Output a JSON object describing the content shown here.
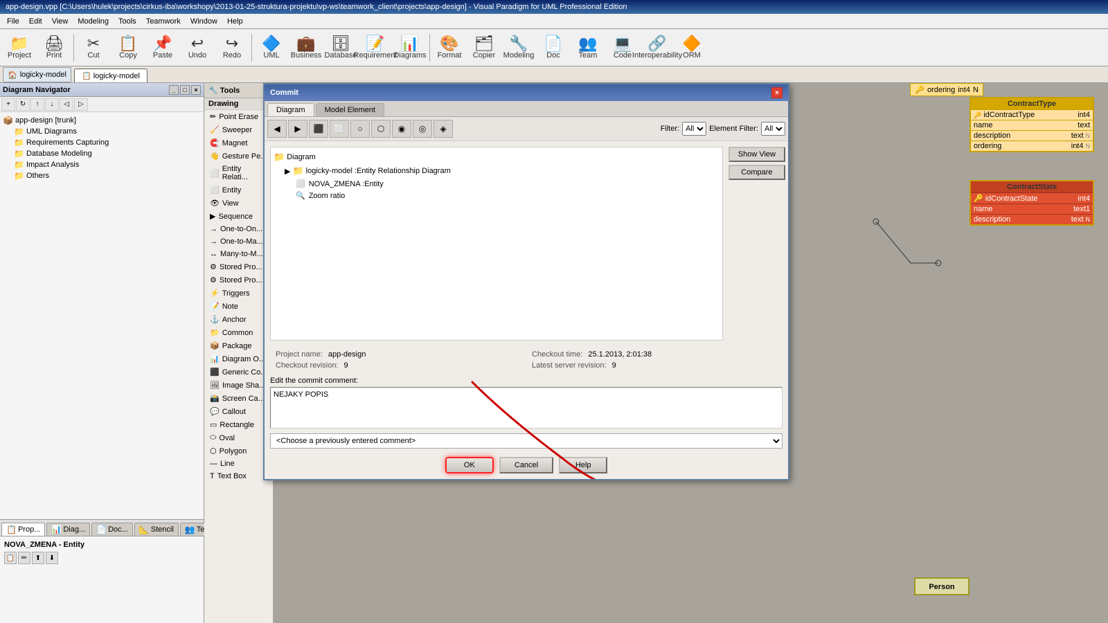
{
  "titlebar": {
    "text": "app-design.vpp [C:\\Users\\hulek\\projects\\cirkus-iba\\workshopy\\2013-01-25-struktura-projektu\\vp-ws\\teamwork_client\\projects\\app-design] - Visual Paradigm for UML Professional Edition"
  },
  "menu": {
    "items": [
      "File",
      "Edit",
      "View",
      "Modeling",
      "Tools",
      "Teamwork",
      "Window",
      "Help"
    ]
  },
  "toolbar": {
    "buttons": [
      {
        "label": "Project",
        "icon": "📁"
      },
      {
        "label": "Print",
        "icon": "🖨"
      },
      {
        "label": "Cut",
        "icon": "✂"
      },
      {
        "label": "Copy",
        "icon": "📋"
      },
      {
        "label": "Paste",
        "icon": "📌"
      },
      {
        "label": "Undo",
        "icon": "↩"
      },
      {
        "label": "Redo",
        "icon": "↪"
      },
      {
        "label": "UML",
        "icon": "🔷"
      },
      {
        "label": "Business",
        "icon": "💼"
      },
      {
        "label": "Database",
        "icon": "🗄"
      },
      {
        "label": "Requirement",
        "icon": "📝"
      },
      {
        "label": "Diagrams",
        "icon": "📊"
      },
      {
        "label": "Format",
        "icon": "🎨"
      },
      {
        "label": "Copier",
        "icon": "🗂"
      },
      {
        "label": "Modeling",
        "icon": "🔧"
      },
      {
        "label": "Doc",
        "icon": "📄"
      },
      {
        "label": "Team",
        "icon": "👥"
      },
      {
        "label": "Code",
        "icon": "💻"
      },
      {
        "label": "Interoperability",
        "icon": "🔗"
      },
      {
        "label": "ORM",
        "icon": "🔶"
      }
    ]
  },
  "nav_panel": {
    "title": "Diagram Navigator",
    "tree": [
      {
        "label": "app-design [trunk]",
        "icon": "📦",
        "level": 0
      },
      {
        "label": "UML Diagrams",
        "icon": "📁",
        "level": 1
      },
      {
        "label": "Requirements Capturing",
        "icon": "📁",
        "level": 1
      },
      {
        "label": "Database Modeling",
        "icon": "📁",
        "level": 1
      },
      {
        "label": "Impact Analysis",
        "icon": "📁",
        "level": 1
      },
      {
        "label": "Others",
        "icon": "📁",
        "level": 1
      }
    ]
  },
  "diagram_tab": "logicky-model",
  "tools_panel": {
    "title": "Tools",
    "items": [
      {
        "label": "Point Erase",
        "icon": "✏"
      },
      {
        "label": "Sweeper",
        "icon": "🧹"
      },
      {
        "label": "Magnet",
        "icon": "🧲"
      },
      {
        "label": "Gesture Pe...",
        "icon": "👋"
      },
      {
        "label": "Entity Relati...",
        "icon": "🔗"
      },
      {
        "label": "Entity",
        "icon": "⬜"
      },
      {
        "label": "View",
        "icon": "👁"
      },
      {
        "label": "Sequence",
        "icon": "▶"
      },
      {
        "label": "One-to-On...",
        "icon": "→"
      },
      {
        "label": "One-to-Ma...",
        "icon": "→"
      },
      {
        "label": "Many-to-M...",
        "icon": "↔"
      },
      {
        "label": "Stored Pro...",
        "icon": "⚙"
      },
      {
        "label": "Stored Pro...",
        "icon": "⚙"
      },
      {
        "label": "Triggers",
        "icon": "⚡"
      },
      {
        "label": "Note",
        "icon": "📝"
      },
      {
        "label": "Anchor",
        "icon": "⚓"
      },
      {
        "label": "Common",
        "icon": "📁"
      },
      {
        "label": "Package",
        "icon": "📦"
      },
      {
        "label": "Diagram O...",
        "icon": "📊"
      },
      {
        "label": "Generic Co...",
        "icon": "⬛"
      },
      {
        "label": "Image Sha...",
        "icon": "🖼"
      },
      {
        "label": "Screen Ca...",
        "icon": "📸"
      },
      {
        "label": "Callout",
        "icon": "💬"
      },
      {
        "label": "Rectangle",
        "icon": "▭"
      },
      {
        "label": "Oval",
        "icon": "⬭"
      },
      {
        "label": "Polygon",
        "icon": "⬡"
      },
      {
        "label": "Line",
        "icon": "—"
      },
      {
        "label": "Text Box",
        "icon": "T"
      }
    ]
  },
  "bottom_tabs": [
    {
      "label": "Prop...",
      "icon": "📋"
    },
    {
      "label": "Diag...",
      "icon": "📊"
    },
    {
      "label": "Doc...",
      "icon": "📄"
    },
    {
      "label": "Stencil",
      "icon": "📐"
    },
    {
      "label": "Te...",
      "icon": "👥"
    }
  ],
  "property": {
    "title": "NOVA_ZMENA - Entity"
  },
  "modal": {
    "title": "Commit",
    "tabs": [
      "Diagram",
      "Model Element"
    ],
    "active_tab": "Diagram",
    "tree": [
      {
        "label": "Diagram",
        "type": "folder"
      },
      {
        "label": "logicky-model :Entity Relationship Diagram",
        "type": "folder",
        "parent": true
      },
      {
        "label": "NOVA_ZMENA :Entity",
        "type": "item"
      },
      {
        "label": "Zoom ratio",
        "type": "item"
      }
    ],
    "show_view_btn": "Show View",
    "compare_btn": "Compare",
    "fields": [
      {
        "label": "Project name:",
        "value": "app-design"
      },
      {
        "label": "Checkout revision:",
        "value": "9"
      },
      {
        "label": "Checkout time:",
        "value": "25.1.2013, 2:01:38"
      },
      {
        "label": "Latest server revision:",
        "value": "9"
      }
    ],
    "comment_label": "Edit the commit comment:",
    "comment_value": "NEJAKY POPIS",
    "dropdown_placeholder": "<Choose a previously entered comment>",
    "buttons": [
      {
        "label": "OK",
        "id": "ok"
      },
      {
        "label": "Cancel",
        "id": "cancel"
      },
      {
        "label": "Help",
        "id": "help"
      }
    ]
  },
  "uml": {
    "contract_type": {
      "title": "ContractType",
      "fields": [
        {
          "key": true,
          "name": "idContractType",
          "type": "int4"
        },
        {
          "key": false,
          "name": "name",
          "type": "text"
        },
        {
          "key": false,
          "name": "description",
          "type": "text",
          "nullable": "N"
        },
        {
          "key": false,
          "name": "ordering",
          "type": "int4",
          "nullable": "N"
        }
      ]
    },
    "contract_state": {
      "title": "ContractState",
      "fields": [
        {
          "key": true,
          "name": "idContractState",
          "type": "int4"
        },
        {
          "key": false,
          "name": "name",
          "type": "text1"
        },
        {
          "key": false,
          "name": "description",
          "type": "text",
          "nullable": "N"
        }
      ]
    },
    "ordering": {
      "name": "ordering",
      "type": "int4",
      "nullable": "N"
    },
    "person": "Person"
  }
}
